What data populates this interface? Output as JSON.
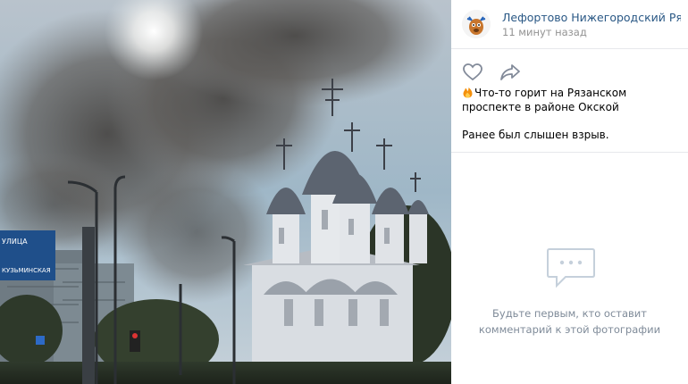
{
  "post": {
    "group_name": "Лефортово Нижегородский Рязан…",
    "time": "11 минут назад",
    "text_line1": "Что-то горит на Рязанском проспекте в районе Окской",
    "text_line2": "Ранее был слышен взрыв."
  },
  "comments": {
    "empty_line1": "Будьте первым, кто оставит",
    "empty_line2": "комментарий к этой фотографии"
  },
  "photo": {
    "signs": {
      "sign_text": "УЛИЦА",
      "sign_text2": "КУЗЬМИНСКАЯ"
    }
  },
  "icons": {
    "like": "heart-icon",
    "share": "share-icon",
    "fire": "fire-emoji",
    "comments": "comments-icon"
  },
  "colors": {
    "link": "#2a5885",
    "muted": "#939393",
    "empty": "#7f8b99",
    "icon": "#828a99"
  }
}
